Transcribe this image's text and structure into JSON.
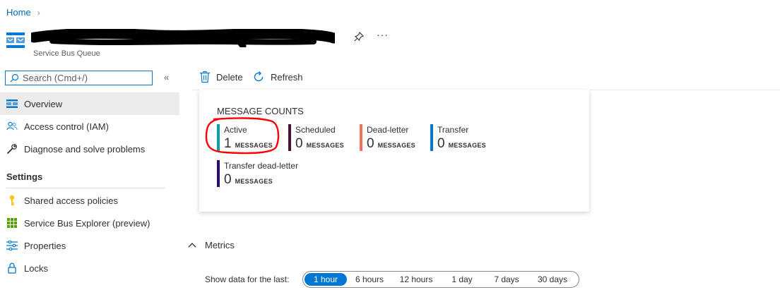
{
  "breadcrumb": {
    "home": "Home",
    "separator": "›"
  },
  "header": {
    "subtitle": "Service Bus Queue",
    "more": "···",
    "icon": "service-bus-queue-icon"
  },
  "search": {
    "placeholder": "Search (Cmd+/)",
    "collapse": "«"
  },
  "nav": {
    "items": [
      {
        "label": "Overview",
        "icon": "overview-icon"
      },
      {
        "label": "Access control (IAM)",
        "icon": "people-icon"
      },
      {
        "label": "Diagnose and solve problems",
        "icon": "wrench-icon"
      }
    ],
    "settings_heading": "Settings",
    "settings_items": [
      {
        "label": "Shared access policies",
        "icon": "key-icon"
      },
      {
        "label": "Service Bus Explorer (preview)",
        "icon": "grid-icon"
      },
      {
        "label": "Properties",
        "icon": "sliders-icon"
      },
      {
        "label": "Locks",
        "icon": "lock-icon"
      }
    ]
  },
  "toolbar": {
    "delete": "Delete",
    "refresh": "Refresh"
  },
  "message_counts": {
    "title": "MESSAGE COUNTS",
    "unit": "MESSAGES",
    "tiles": [
      {
        "label": "Active",
        "count": "1",
        "color": "#00a2ad"
      },
      {
        "label": "Scheduled",
        "count": "0",
        "color": "#4b1236"
      },
      {
        "label": "Dead-letter",
        "count": "0",
        "color": "#f2705a"
      },
      {
        "label": "Transfer",
        "count": "0",
        "color": "#0078d4"
      },
      {
        "label": "Transfer dead-letter",
        "count": "0",
        "color": "#2d0a7a"
      }
    ]
  },
  "metrics": {
    "label": "Metrics",
    "show_label": "Show data for the last:",
    "ranges": [
      "1 hour",
      "6 hours",
      "12 hours",
      "1 day",
      "7 days",
      "30 days"
    ],
    "selected": "1 hour"
  },
  "colors": {
    "accent": "#0078d4",
    "annotation": "#ff0000",
    "link": "#0067b8"
  }
}
